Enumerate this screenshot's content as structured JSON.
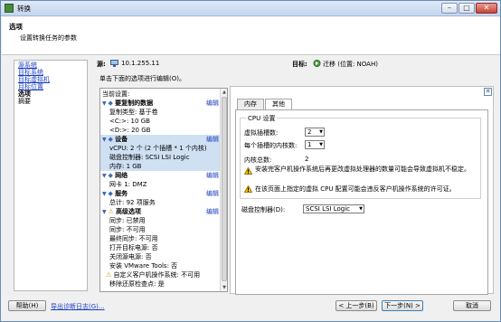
{
  "window": {
    "title": "转换"
  },
  "header": {
    "title": "选项",
    "subtitle": "设置转换任务的参数"
  },
  "nav": {
    "items": [
      {
        "label": "源系统",
        "link": true
      },
      {
        "label": "目标系统",
        "link": true
      },
      {
        "label": "目标虚拟机",
        "link": true
      },
      {
        "label": "目标位置",
        "link": true
      },
      {
        "label": "选项",
        "link": false
      },
      {
        "label": "摘要",
        "link": false
      }
    ]
  },
  "source": {
    "label": "源:",
    "value": "10.1.255.11"
  },
  "target": {
    "label": "目标:",
    "value": "迁移 (位置: NOAH)"
  },
  "instruction": "单击下面的选项进行编辑(O)。",
  "tree": {
    "header": "当前设置:",
    "edit_label": "编辑",
    "rows": [
      {
        "text": "要复制的数据",
        "kind": "section",
        "edit": true
      },
      {
        "text": "复制类型: 基于卷"
      },
      {
        "text": "<C:>: 10 GB"
      },
      {
        "text": "<D:>: 20 GB"
      },
      {
        "text": "设备",
        "kind": "section",
        "edit": true,
        "selected": true
      },
      {
        "text": "vCPU: 2 个 (2 个插槽 * 1 个内核)",
        "selected": true
      },
      {
        "text": "磁盘控制器: SCSI LSI Logic",
        "selected": true
      },
      {
        "text": "内存: 1 GB",
        "selected": true
      },
      {
        "text": "网络",
        "kind": "section",
        "edit": true
      },
      {
        "text": "网卡 1: DMZ"
      },
      {
        "text": "服务",
        "kind": "section",
        "edit": true
      },
      {
        "text": "总计: 92 项服务"
      },
      {
        "text": "高级选项",
        "kind": "section-warn",
        "edit": true
      },
      {
        "text": "同步: 已禁用"
      },
      {
        "text": "同步: 不可用"
      },
      {
        "text": "最终同步: 不可用"
      },
      {
        "text": "打开目标电源: 否"
      },
      {
        "text": "关闭源电源: 否"
      },
      {
        "text": "安装 VMware Tools: 否"
      },
      {
        "text": "自定义客户机操作系统: 不可用",
        "warn": true
      },
      {
        "text": "移除还原检查点: 是"
      }
    ]
  },
  "tabs": [
    {
      "label": "内存"
    },
    {
      "label": "其他"
    }
  ],
  "cpu": {
    "group_title": "CPU 设置",
    "sockets_label": "虚拟插槽数:",
    "sockets_value": "2",
    "cores_label": "每个插槽的内核数:",
    "cores_value": "1",
    "total_label": "内核总数:",
    "total_value": "2",
    "warning1": "安装完客户机操作系统后再更改虚拟处理器的数量可能会导致虚拟机不稳定。",
    "warning2": "在该页面上指定的虚拟 CPU 配置可能会违反客户机操作系统的许可证。"
  },
  "disk_controller": {
    "label": "磁盘控制器(D):",
    "value": "SCSI LSI Logic"
  },
  "footer": {
    "help": "帮助(H)",
    "export_log": "导出诊断日志(G)...",
    "back": "< 上一步(B)",
    "next": "下一步(N) >",
    "cancel": "取消"
  }
}
